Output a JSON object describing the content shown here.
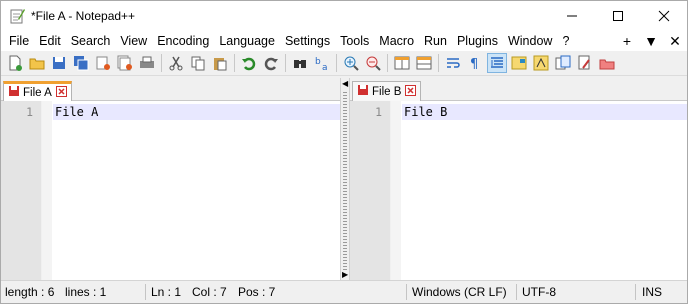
{
  "window": {
    "title": "*File A - Notepad++",
    "controls": {
      "minimize": "minimize",
      "maximize": "maximize",
      "close": "close"
    }
  },
  "menu": {
    "items": [
      "File",
      "Edit",
      "Search",
      "View",
      "Encoding",
      "Language",
      "Settings",
      "Tools",
      "Macro",
      "Run",
      "Plugins",
      "Window",
      "?"
    ],
    "right": [
      "+",
      "▼",
      "✕"
    ]
  },
  "toolbar": {
    "icons": [
      "new-file-icon",
      "open-file-icon",
      "save-icon",
      "save-all-icon",
      "close-icon",
      "close-all-icon",
      "print-icon",
      "cut-icon",
      "copy-icon",
      "paste-icon",
      "undo-icon",
      "redo-icon",
      "find-icon",
      "replace-icon",
      "zoom-in-icon",
      "zoom-out-icon",
      "sync-vertical-icon",
      "sync-horizontal-icon",
      "word-wrap-icon",
      "show-all-chars-icon",
      "indent-guide-icon",
      "doc-map-icon",
      "function-list-icon",
      "folder-as-workspace-icon",
      "monitoring-icon",
      "macro-record-icon",
      "macro-stop-icon"
    ],
    "active_icon": "indent-guide-icon"
  },
  "left_pane": {
    "tab": {
      "label": "File A",
      "modified": true
    },
    "line_number": "1",
    "line_text": "File A"
  },
  "right_pane": {
    "tab": {
      "label": "File B",
      "modified": false
    },
    "line_number": "1",
    "line_text": "File B"
  },
  "status": {
    "length": "length : 6",
    "lines": "lines : 1",
    "ln": "Ln : 1",
    "col": "Col : 7",
    "pos": "Pos : 7",
    "eol": "Windows (CR LF)",
    "encoding": "UTF-8",
    "mode": "INS"
  },
  "colors": {
    "current_line": "#e8e8ff",
    "active_tab_accent": "#f0a030",
    "tab_close": "#d03030"
  }
}
